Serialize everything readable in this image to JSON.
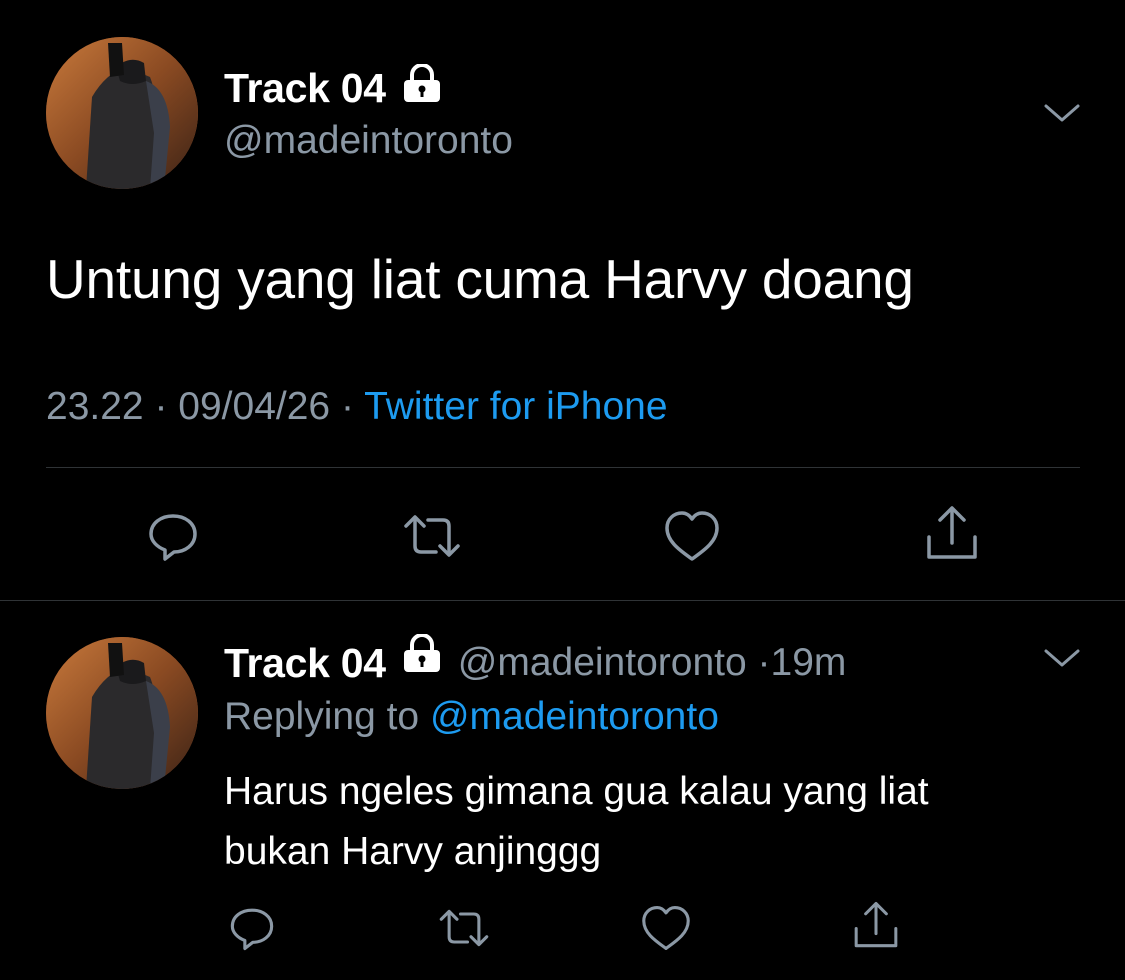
{
  "colors": {
    "background": "#000000",
    "text_primary": "#ffffff",
    "text_secondary": "#8b98a5",
    "accent": "#1d9bf0",
    "divider": "#2f3336"
  },
  "main_tweet": {
    "display_name": "Track 04",
    "handle": "@madeintoronto",
    "text": "Untung yang liat cuma Harvy doang",
    "time": "23.22",
    "date": "09/04/26",
    "source": "Twitter for iPhone",
    "separator": "·",
    "icons": {
      "lock": "lock-icon",
      "more": "chevron-down-icon",
      "reply": "reply-icon",
      "retweet": "retweet-icon",
      "like": "heart-icon",
      "share": "share-icon"
    }
  },
  "reply_tweet": {
    "display_name": "Track 04",
    "handle": "@madeintoronto",
    "separator": "·",
    "time_ago": "19m",
    "replying_prefix": "Replying to",
    "replying_to": "@madeintoronto",
    "text": "Harus ngeles gimana gua kalau yang liat\nbukan Harvy anjinggg"
  }
}
